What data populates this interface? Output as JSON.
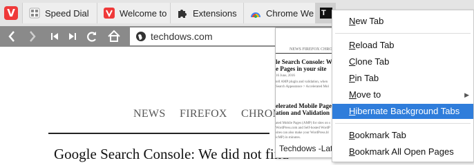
{
  "tabs": [
    {
      "title": "Speed Dial",
      "icon": "vivaldi-icon"
    },
    {
      "title": "Welcome to",
      "icon": "vivaldi-icon"
    },
    {
      "title": "Extensions",
      "icon": "puzzle-icon"
    },
    {
      "title": "Chrome Web",
      "icon": "chrome-webstore-icon"
    },
    {
      "title": "T",
      "icon": "techdows-favicon"
    }
  ],
  "address": {
    "url": "techdows.com"
  },
  "page": {
    "nav": [
      "NEWS",
      "FIREFOX",
      "CHROM"
    ],
    "headline": "Google Search Console: We did not find"
  },
  "preview": {
    "caption": "Techdows -Lat",
    "nav": "NEWS  FIREFOX  CHRO",
    "line1": "le Search Console: We did",
    "line2": "e Pages in your site",
    "date1": "16 June, 2016",
    "small1": "tell AMP plugin and validation, when",
    "small2": "Search Appearance > Accelerated Mol",
    "line3": "elerated Mobile Pages (AM",
    "line4": "ation and Validation",
    "small3": "ated Mobile Pages (AMP) for sites on s",
    "small4": "WordPress.com and Self-hosted WordP",
    "small5": "sites can also make your WordPress.bl",
    "small6": "icMP) in minutes."
  },
  "menu": {
    "items": [
      {
        "accel": "N",
        "rest": "ew Tab"
      },
      {
        "accel": "R",
        "rest": "eload Tab"
      },
      {
        "accel": "C",
        "rest": "lone Tab"
      },
      {
        "accel": "P",
        "rest": "in Tab"
      },
      {
        "accel": "M",
        "rest": "ove to"
      },
      {
        "accel": "H",
        "rest": "ibernate Background Tabs"
      },
      {
        "accel": "B",
        "rest": "ookmark Tab"
      },
      {
        "accel": "B",
        "rest": "ookmark All Open Pages"
      }
    ]
  },
  "colors": {
    "brand": "#ef3939",
    "highlight": "#2f7ddb",
    "navbar": "#8a8a8a"
  }
}
